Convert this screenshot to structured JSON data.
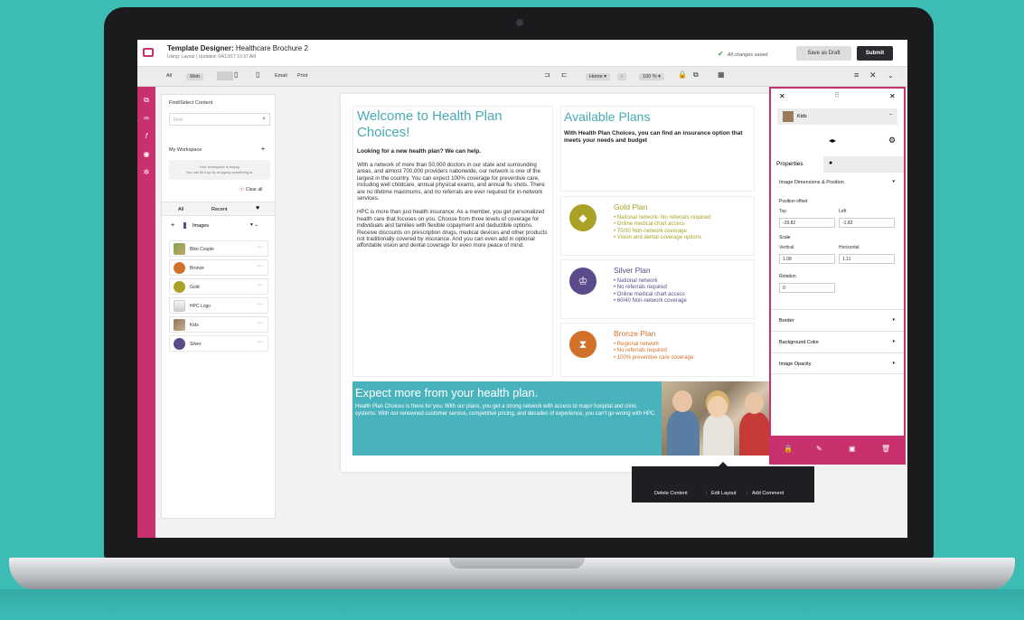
{
  "header": {
    "title_bold": "Template Designer:",
    "title_rest": " Healthcare Brochure 2",
    "subtitle": "Using: Layout  |  Updated: 04/13/17 10:37 AM",
    "saved": "All changes saved",
    "save_draft": "Save as Draft",
    "submit": "Submit"
  },
  "toolbar": {
    "all": "All",
    "web": "Web",
    "email": "Email",
    "print": "Print",
    "page_select": "Home ▾",
    "zoom": "100 % ▾"
  },
  "left_panel": {
    "heading": "Find/Select Content",
    "find_placeholder": "Find",
    "workspace": "My Workspace",
    "workspace_empty_line1": "Your workspace is empty.",
    "workspace_empty_line2": "You can fill it up by dropping something in.",
    "clear_all": "Clear all",
    "tabs": [
      "All",
      "Recent"
    ],
    "images_label": "Images",
    "items": [
      {
        "name": "Bike Couple"
      },
      {
        "name": "Bronze"
      },
      {
        "name": "Gold"
      },
      {
        "name": "HPC Logo"
      },
      {
        "name": "Kids"
      },
      {
        "name": "Silver"
      }
    ]
  },
  "doc": {
    "heading": "Welcome to Health Plan Choices!",
    "lead": "Looking for a new health plan?  We can help.",
    "para1": "With a network of more than 50,000 doctors in our state and surrounding areas, and almost 700,000 providers nationwide, our network is one of the largest in the country.  You can expect 100% coverage for preventive care, including well childcare, annual physical exams, and annual flu shots. There are no lifetime maximums, and no referrals are ever required for in-network services.",
    "para2": "HPC is more than just health insurance.  As a member, you get personalized health care that focuses on you. Choose from three levels of coverage for individuals and families with flexible copayment and deductible options. Receive discounts on prescription drugs, medical devices and other products not traditionally covered by insurance. And you can even add in optional affordable vision and dental coverage for even more peace of mind.",
    "plans_heading": "Available Plans",
    "plans_lead": "With Health Plan Choices, you can find an insurance option that meets your needs and budget",
    "plans": [
      {
        "name": "Gold Plan",
        "color": "#a9a226",
        "items": [
          "National network- No referrals required",
          "Online medical chart access",
          "70/30 Non-network coverage",
          "Vision and dental coverage options"
        ]
      },
      {
        "name": "Silver Plan",
        "color": "#5c4b8a",
        "items": [
          "National network",
          "No referrals required",
          "Online medical chart access",
          "60/40 Non-network coverage"
        ]
      },
      {
        "name": "Bronze Plan",
        "color": "#d2722a",
        "items": [
          "Regional network",
          "No referrals required",
          "100% preventive care coverage"
        ]
      }
    ],
    "banner_heading": "Expect more from your health plan.",
    "banner_text": "Health Plan Choices is there for you. With our plans, you get a strong network with access to major hospital and clinic systems. With our renowned customer service, competitive pricing, and decades of experience, you can't go wrong with HPC."
  },
  "popup": {
    "delete": "Delete Content",
    "edit": "Edit Layout",
    "comment": "Add Comment"
  },
  "props": {
    "selected": "Kids",
    "tab_properties": "Properties",
    "section_dims": "Image Dimensions & Position",
    "position_offset": "Position offset",
    "top_label": "Top",
    "left_label": "Left",
    "top_value": "-39.82",
    "left_value": "-1.82",
    "scale": "Scale",
    "vertical_label": "Vertical",
    "horizontal_label": "Horizontal",
    "vertical_value": "1.08",
    "horizontal_value": "1.11",
    "rotation": "Rotation",
    "rotation_value": "0",
    "border": "Border",
    "background_color": "Background Color",
    "image_opacity": "Image Opacity"
  },
  "colors": {
    "accent": "#c9306e",
    "teal": "#49aab4",
    "background": "#3dbcb6"
  }
}
